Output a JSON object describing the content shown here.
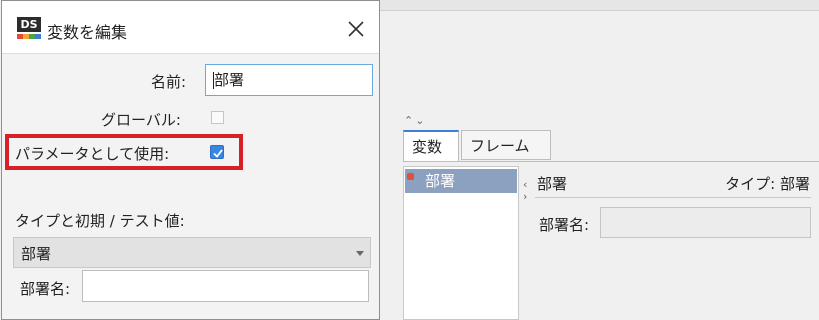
{
  "dialog": {
    "title": "変数を編集",
    "logo_text": "DS",
    "fields": {
      "name_label": "名前:",
      "name_value": "部署",
      "global_label": "グローバル:",
      "global_checked": false,
      "param_label": "パラメータとして使用:",
      "param_checked": true,
      "type_section_label": "タイプと初期 / テスト値:",
      "type_selected": "部署",
      "dept_name_label": "部署名:",
      "dept_name_value": ""
    }
  },
  "background_panel": {
    "tabs": [
      "変数",
      "フレーム"
    ],
    "list_items": [
      "部署"
    ],
    "detail_title": "部署",
    "detail_type": "タイプ: 部署",
    "detail_field_label": "部署名:",
    "detail_field_value": ""
  },
  "colors": {
    "highlight_border": "#d6202a",
    "checkbox_checked": "#3a86e0",
    "selected_list_item": "#8ca0bf",
    "active_tab_accent": "#3b7fd9"
  }
}
